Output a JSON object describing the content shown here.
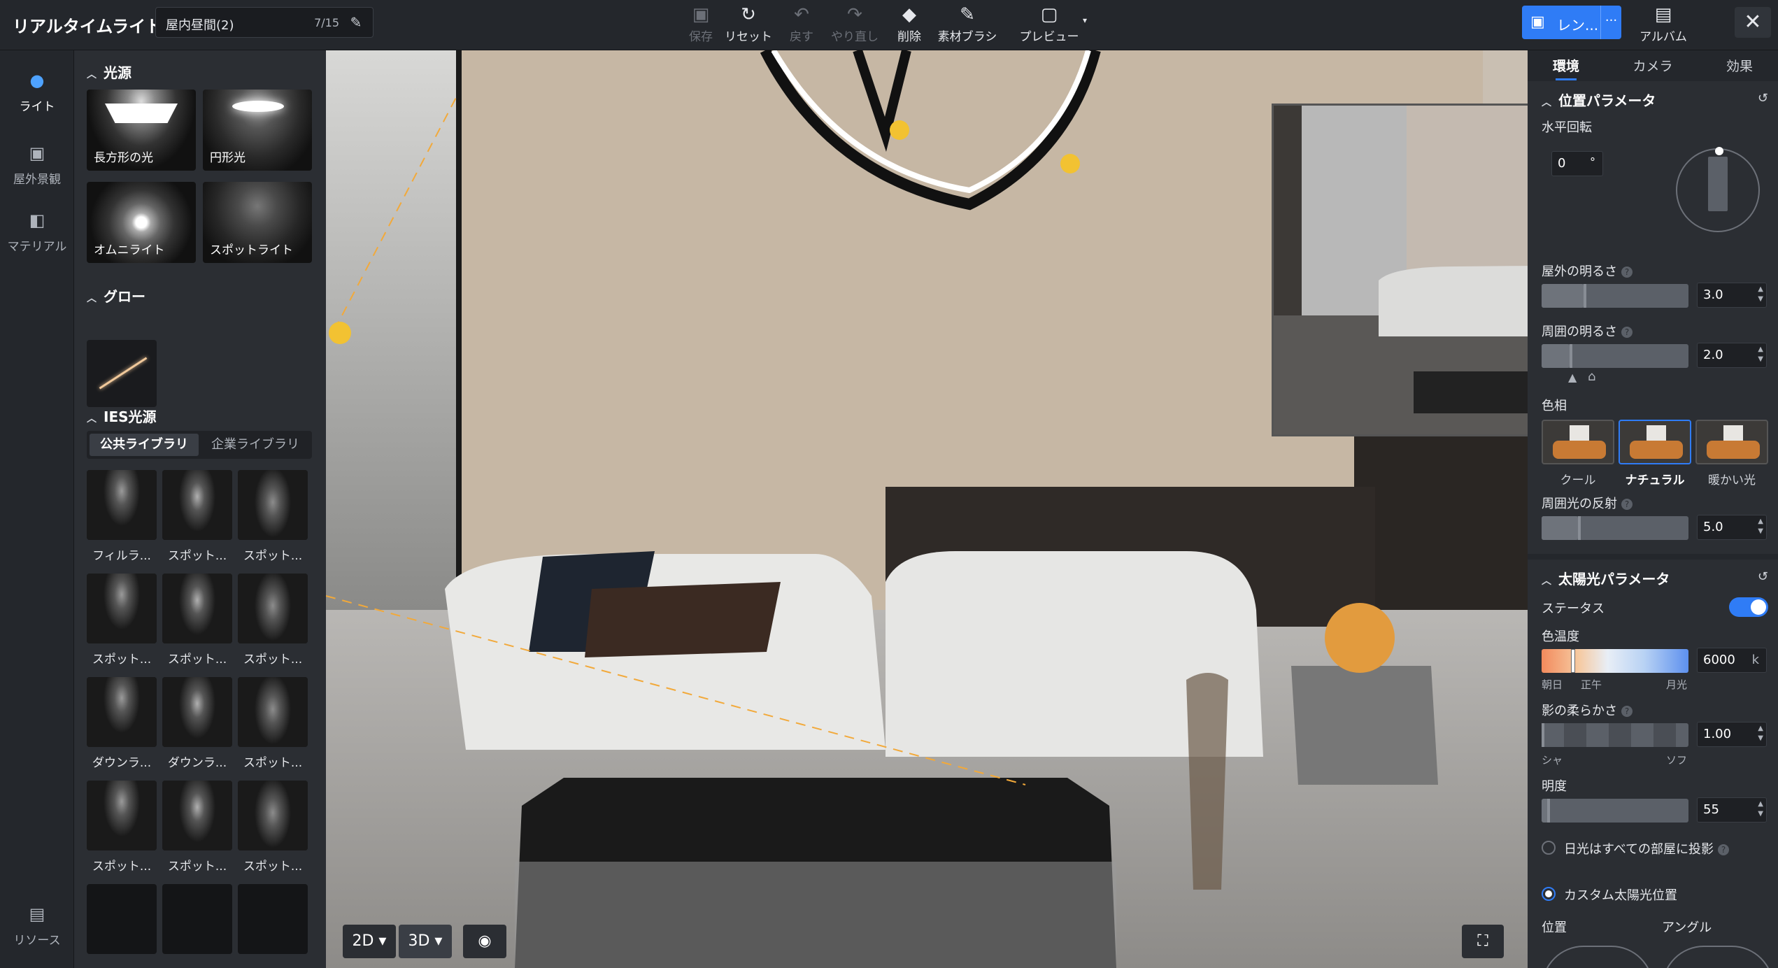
{
  "app": {
    "title": "リアルタイムライト",
    "scene_name": "屋内昼間(2)",
    "scene_count": "7/15"
  },
  "toolbar": {
    "save": "保存",
    "reset": "リセット",
    "undo": "戻す",
    "redo": "やり直し",
    "delete": "削除",
    "brush": "素材ブラシ",
    "preview": "プレビュー",
    "render": "レン...",
    "album": "アルバム"
  },
  "leftnav": {
    "light": "ライト",
    "outdoor": "屋外景観",
    "material": "マテリアル",
    "resource": "リソース"
  },
  "panel": {
    "light_source_heading": "光源",
    "lights": [
      "長方形の光",
      "円形光",
      "オムニライト",
      "スポットライト"
    ],
    "glow_heading": "グロー",
    "ies_heading": "IES光源",
    "lib_tabs": [
      "公共ライブラリ",
      "企業ライブラリ"
    ],
    "ies_items": [
      "フィルラ...",
      "スポット...",
      "スポット...",
      "スポット...",
      "スポット...",
      "スポット...",
      "ダウンラ...",
      "ダウンラ...",
      "スポット...",
      "スポット...",
      "スポット...",
      "スポット..."
    ]
  },
  "viewport": {
    "mode_2d": "2D",
    "mode_3d": "3D"
  },
  "right": {
    "tabs": [
      "環境",
      "カメラ",
      "効果"
    ],
    "position_heading": "位置パラメータ",
    "horizontal_rotation": "水平回転",
    "rotation_value": "0",
    "rotation_unit": "°",
    "outdoor_brightness": "屋外の明るさ",
    "outdoor_brightness_value": "3.0",
    "ambient_brightness": "周囲の明るさ",
    "ambient_brightness_value": "2.0",
    "hue_label": "色相",
    "hues": [
      "クール",
      "ナチュラル",
      "暖かい光"
    ],
    "ambient_reflection": "周囲光の反射",
    "ambient_reflection_value": "5.0",
    "sun_heading": "太陽光パラメータ",
    "status": "ステータス",
    "color_temp": "色温度",
    "color_temp_value": "6000",
    "color_temp_unit": "k",
    "ct_labels": [
      "朝日",
      "正午",
      "月光"
    ],
    "shadow_softness": "影の柔らかさ",
    "shadow_value": "1.00",
    "shadow_labels": [
      "シャ",
      "ソフ"
    ],
    "brightness": "明度",
    "brightness_value": "55",
    "sun_all_rooms": "日光はすべての部屋に投影",
    "custom_sun": "カスタム太陽光位置",
    "position": "位置",
    "angle": "アングル"
  },
  "colors": {
    "accent": "#2f7cf6",
    "bg": "#1b1d21",
    "panel": "#2b2e33"
  }
}
